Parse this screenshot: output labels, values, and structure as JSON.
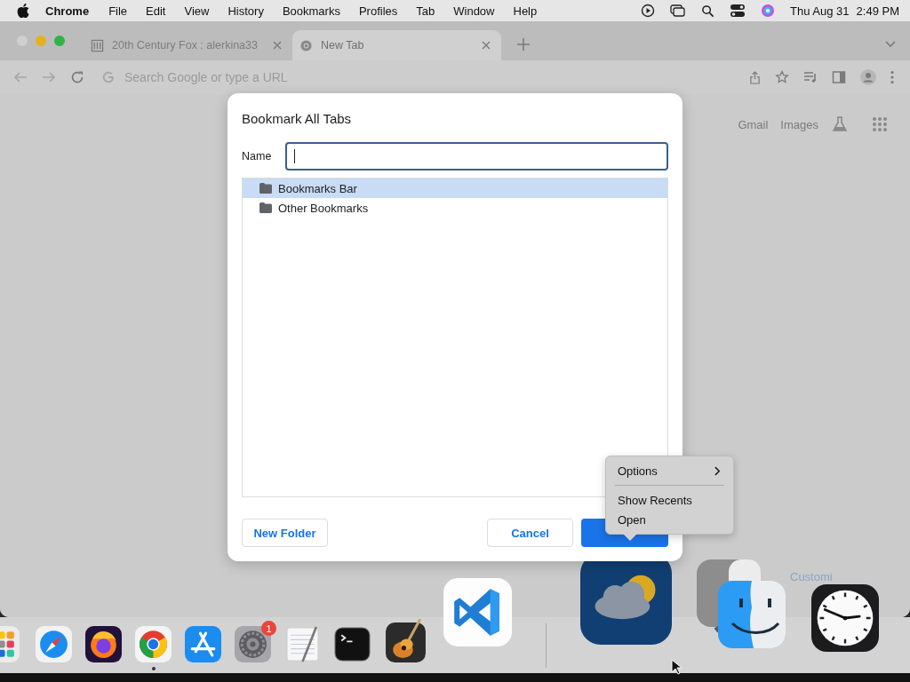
{
  "menu_bar": {
    "app": "Chrome",
    "menus": [
      "File",
      "Edit",
      "View",
      "History",
      "Bookmarks",
      "Profiles",
      "Tab",
      "Window",
      "Help"
    ],
    "date": "Thu Aug 31",
    "time": "2:49 PM"
  },
  "tabs": [
    {
      "title": "20th Century Fox : alerkina33",
      "selected": false
    },
    {
      "title": "New Tab",
      "selected": true
    }
  ],
  "omnibox": {
    "placeholder": "Search Google or type a URL"
  },
  "page": {
    "links": [
      "Gmail",
      "Images"
    ],
    "customize_link": "Customi"
  },
  "dialog": {
    "title": "Bookmark All Tabs",
    "name_label": "Name",
    "folders": [
      {
        "label": "Bookmarks Bar",
        "selected": true
      },
      {
        "label": "Other Bookmarks",
        "selected": false
      }
    ],
    "buttons": [
      {
        "label": "New Folder",
        "kind": "plain"
      },
      {
        "label": "Cancel",
        "kind": "plain"
      },
      {
        "kind": "primary"
      }
    ]
  },
  "context_menu": {
    "items": [
      {
        "label": "Options",
        "kind": "submenu"
      },
      {
        "kind": "separator"
      },
      {
        "label": "Show Recents",
        "kind": "item"
      },
      {
        "label": "Open",
        "kind": "item"
      }
    ]
  },
  "dock": {
    "apps": [
      {
        "kind": "launchpad",
        "running": false
      },
      {
        "kind": "safari",
        "running": false
      },
      {
        "kind": "firefox",
        "running": false
      },
      {
        "kind": "chrome",
        "running": true
      },
      {
        "kind": "appstore",
        "running": false
      },
      {
        "kind": "settings",
        "running": false,
        "badge": "1"
      },
      {
        "kind": "textedit",
        "running": false
      },
      {
        "kind": "terminal",
        "running": false
      },
      {
        "kind": "garageband",
        "running": false
      },
      {
        "kind": "vscode",
        "running": false
      },
      {
        "kind": "separator"
      },
      {
        "kind": "weather",
        "running": false
      },
      {
        "kind": "finder",
        "running": false
      },
      {
        "kind": "clock",
        "running": false
      }
    ]
  }
}
